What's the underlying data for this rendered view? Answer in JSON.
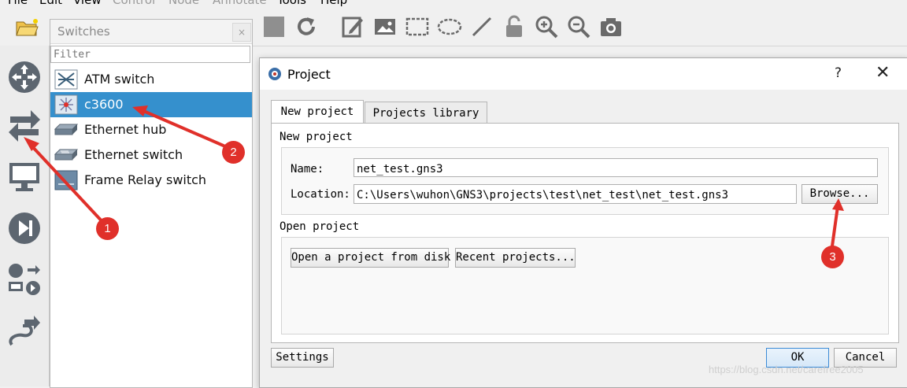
{
  "menu": {
    "items": [
      {
        "label": "File",
        "disabled": false
      },
      {
        "label": "Edit",
        "disabled": false
      },
      {
        "label": "View",
        "disabled": false
      },
      {
        "label": "Control",
        "disabled": true
      },
      {
        "label": "Node",
        "disabled": true
      },
      {
        "label": "Annotate",
        "disabled": true
      },
      {
        "label": "Tools",
        "disabled": false
      },
      {
        "label": "Help",
        "disabled": false
      }
    ]
  },
  "toolbar": {
    "icons": [
      "open-folder-icon",
      "reload-icon",
      "edit-note-icon",
      "insert-picture-icon",
      "draw-rectangle-icon",
      "draw-ellipse-icon",
      "draw-line-icon",
      "lock-icon",
      "zoom-in-icon",
      "zoom-out-icon",
      "screenshot-icon"
    ]
  },
  "left_dock": {
    "icons": [
      "routers-icon",
      "switches-icon",
      "end-devices-icon",
      "security-devices-icon",
      "all-devices-icon",
      "add-link-icon"
    ]
  },
  "switches_panel": {
    "title": "Switches",
    "close_glyph": "×",
    "filter_placeholder": "Filter",
    "items": [
      {
        "label": "ATM switch",
        "icon": "atm-switch-icon",
        "selected": false
      },
      {
        "label": "c3600",
        "icon": "c3600-icon",
        "selected": true
      },
      {
        "label": "Ethernet hub",
        "icon": "ethernet-hub-icon",
        "selected": false
      },
      {
        "label": "Ethernet switch",
        "icon": "ethernet-switch-icon",
        "selected": false
      },
      {
        "label": "Frame Relay switch",
        "icon": "frame-relay-switch-icon",
        "selected": false
      }
    ]
  },
  "dialog": {
    "title": "Project",
    "help_glyph": "?",
    "close_glyph": "✕",
    "tabs": [
      {
        "label": "New project",
        "active": true
      },
      {
        "label": "Projects library",
        "active": false
      }
    ],
    "new_project": {
      "section_label": "New project",
      "name_label": "Name:",
      "name_value": "net_test.gns3",
      "location_label": "Location:",
      "location_value": "C:\\Users\\wuhon\\GNS3\\projects\\test\\net_test\\net_test.gns3",
      "browse_label": "Browse..."
    },
    "open_project": {
      "section_label": "Open project",
      "open_disk_label": "Open a project from disk",
      "recent_label": "Recent projects..."
    },
    "settings_label": "Settings",
    "ok_label": "OK",
    "cancel_label": "Cancel"
  },
  "annotations": {
    "color": "#e0302a",
    "callouts": [
      "1",
      "2",
      "3"
    ]
  },
  "watermark": "https://blog.csdn.net/carefree2005"
}
